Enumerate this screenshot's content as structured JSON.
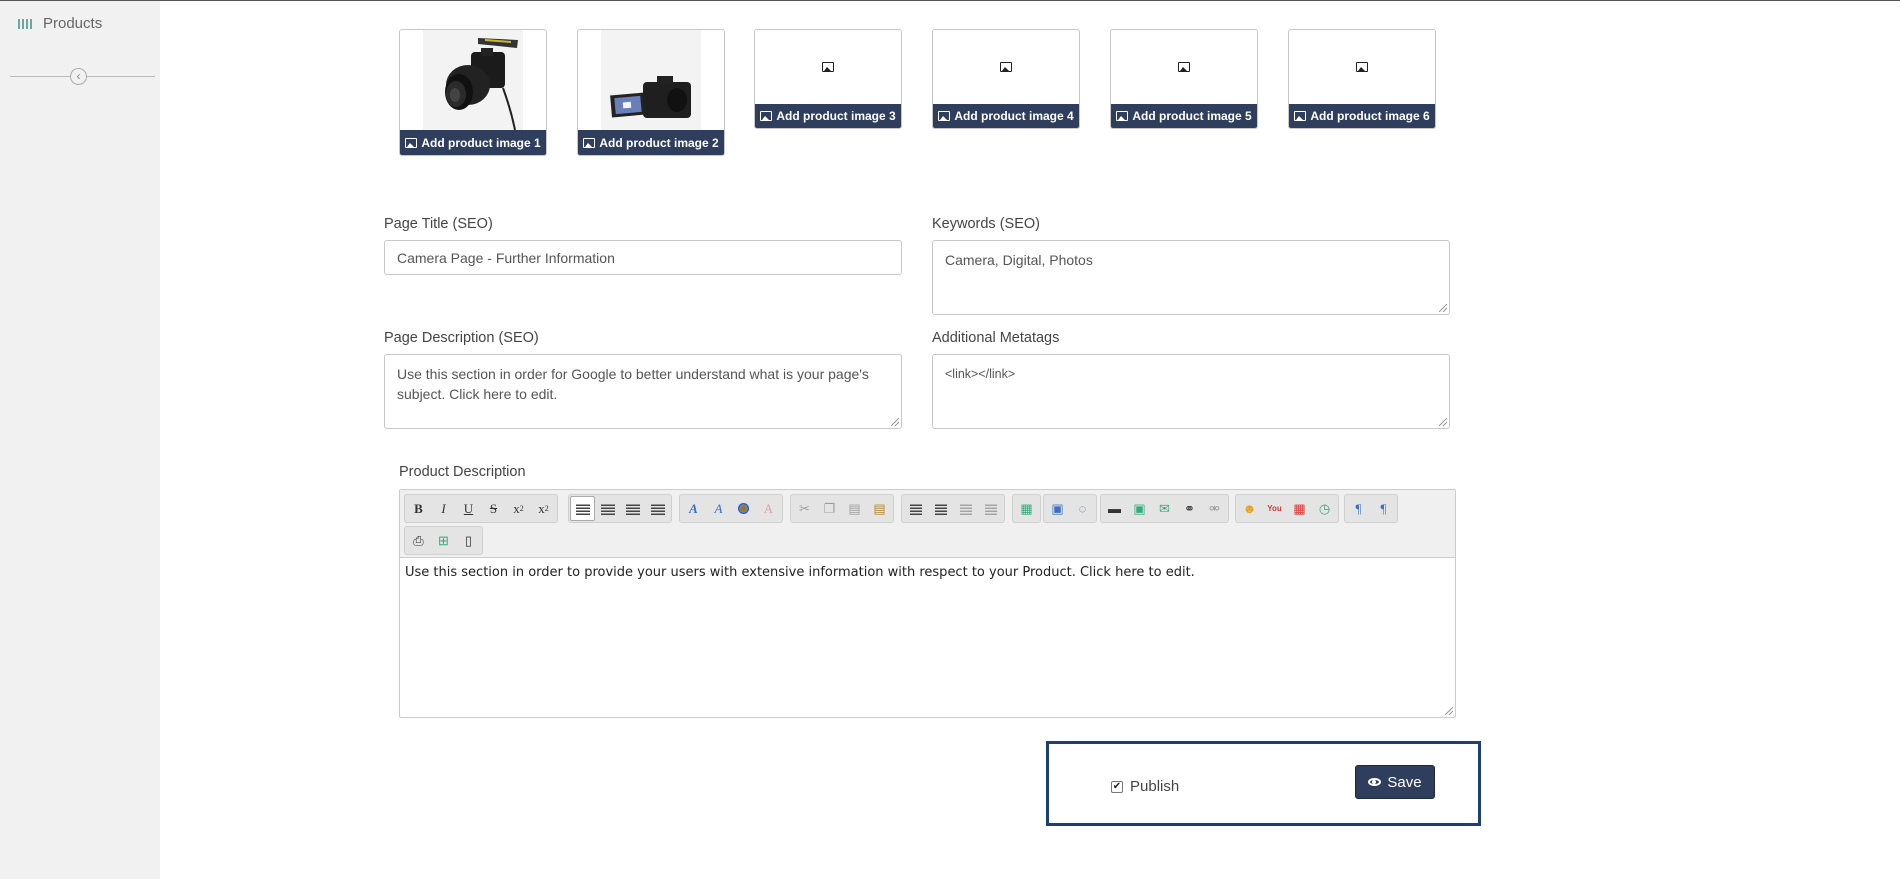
{
  "sidebar": {
    "items": [
      {
        "label": "Products",
        "icon": "barcode-icon"
      }
    ],
    "collapse_icon": "chevron-left-icon"
  },
  "images": [
    {
      "label": "Add product image 1",
      "has_photo": true
    },
    {
      "label": "Add product image 2",
      "has_photo": true
    },
    {
      "label": "Add product image 3",
      "has_photo": false
    },
    {
      "label": "Add product image 4",
      "has_photo": false
    },
    {
      "label": "Add product image 5",
      "has_photo": false
    },
    {
      "label": "Add product image 6",
      "has_photo": false
    }
  ],
  "seo": {
    "page_title_label": "Page Title (SEO)",
    "page_title_value": "Camera Page - Further Information",
    "keywords_label": "Keywords (SEO)",
    "keywords_value": "Camera, Digital, Photos",
    "page_description_label": "Page Description (SEO)",
    "page_description_value": "Use this section in order for Google to better understand what is your page's subject. Click here to edit.",
    "metatags_label": "Additional Metatags",
    "metatags_value": "<link></link>"
  },
  "product_description": {
    "label": "Product Description",
    "content": "Use this section in order to provide your users with extensive information with respect to your Product. Click here to edit."
  },
  "publish": {
    "label": "Publish",
    "checked": true,
    "save_label": "Save"
  },
  "colors": {
    "primary": "#2e3e5c",
    "publish_border": "#1d3e78",
    "sidebar_bg": "#f1f1f1"
  }
}
